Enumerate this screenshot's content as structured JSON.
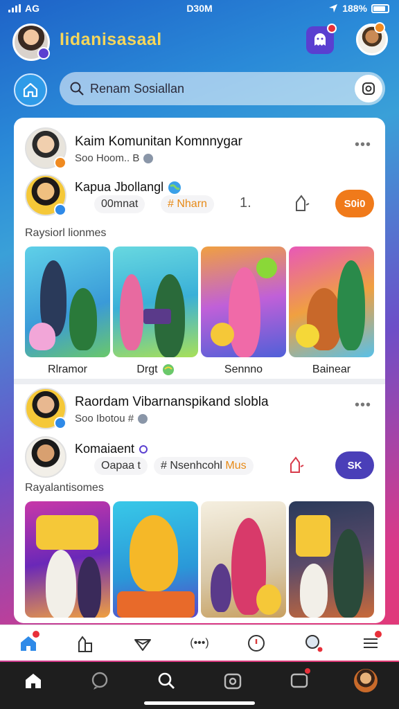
{
  "status_bar": {
    "carrier": "AG",
    "time": "D30M",
    "battery": "188%"
  },
  "header": {
    "title": "Iidanisasaal"
  },
  "search": {
    "placeholder": "Renam Sosiallan"
  },
  "posts": [
    {
      "author": "Kaim Komunitan Komnnygar",
      "meta": "Soo Hoom.. B",
      "sub_name": "Kapua Jbollangl",
      "chip1": "00mnat",
      "chip2": "# Nharn",
      "count": "1.",
      "action": "S0i0",
      "action_color": "#f07a1a",
      "section": "Raysiorl lionmes",
      "captions": [
        "Rlramor",
        "Drgt",
        "Sennno",
        "Bainear"
      ]
    },
    {
      "author": "Raordam Vibarnanspikand slobla",
      "meta": "Soo Ibotou #",
      "sub_name": "Komaiaent",
      "chip1": "Oapaa t",
      "chip2": "# Nsenhcohl",
      "chip3": "Mus",
      "action": "SK",
      "action_color": "#4a3fb8",
      "section": "Rayalantisomes"
    }
  ],
  "colors": {
    "brand_title": "#f5d65a",
    "accent_blue": "#2f9be8",
    "notification": "#e8303a"
  },
  "icons": {
    "tab_bar": [
      "home-icon",
      "shop-icon",
      "heart-icon",
      "message-icon",
      "clock-icon",
      "search-icon",
      "menu-icon"
    ],
    "bottom_nav": [
      "home-icon",
      "chat-icon",
      "search-icon",
      "camera-icon",
      "notification-icon",
      "profile-avatar"
    ]
  },
  "tab_bar": {
    "messages_label": "(•••)"
  }
}
